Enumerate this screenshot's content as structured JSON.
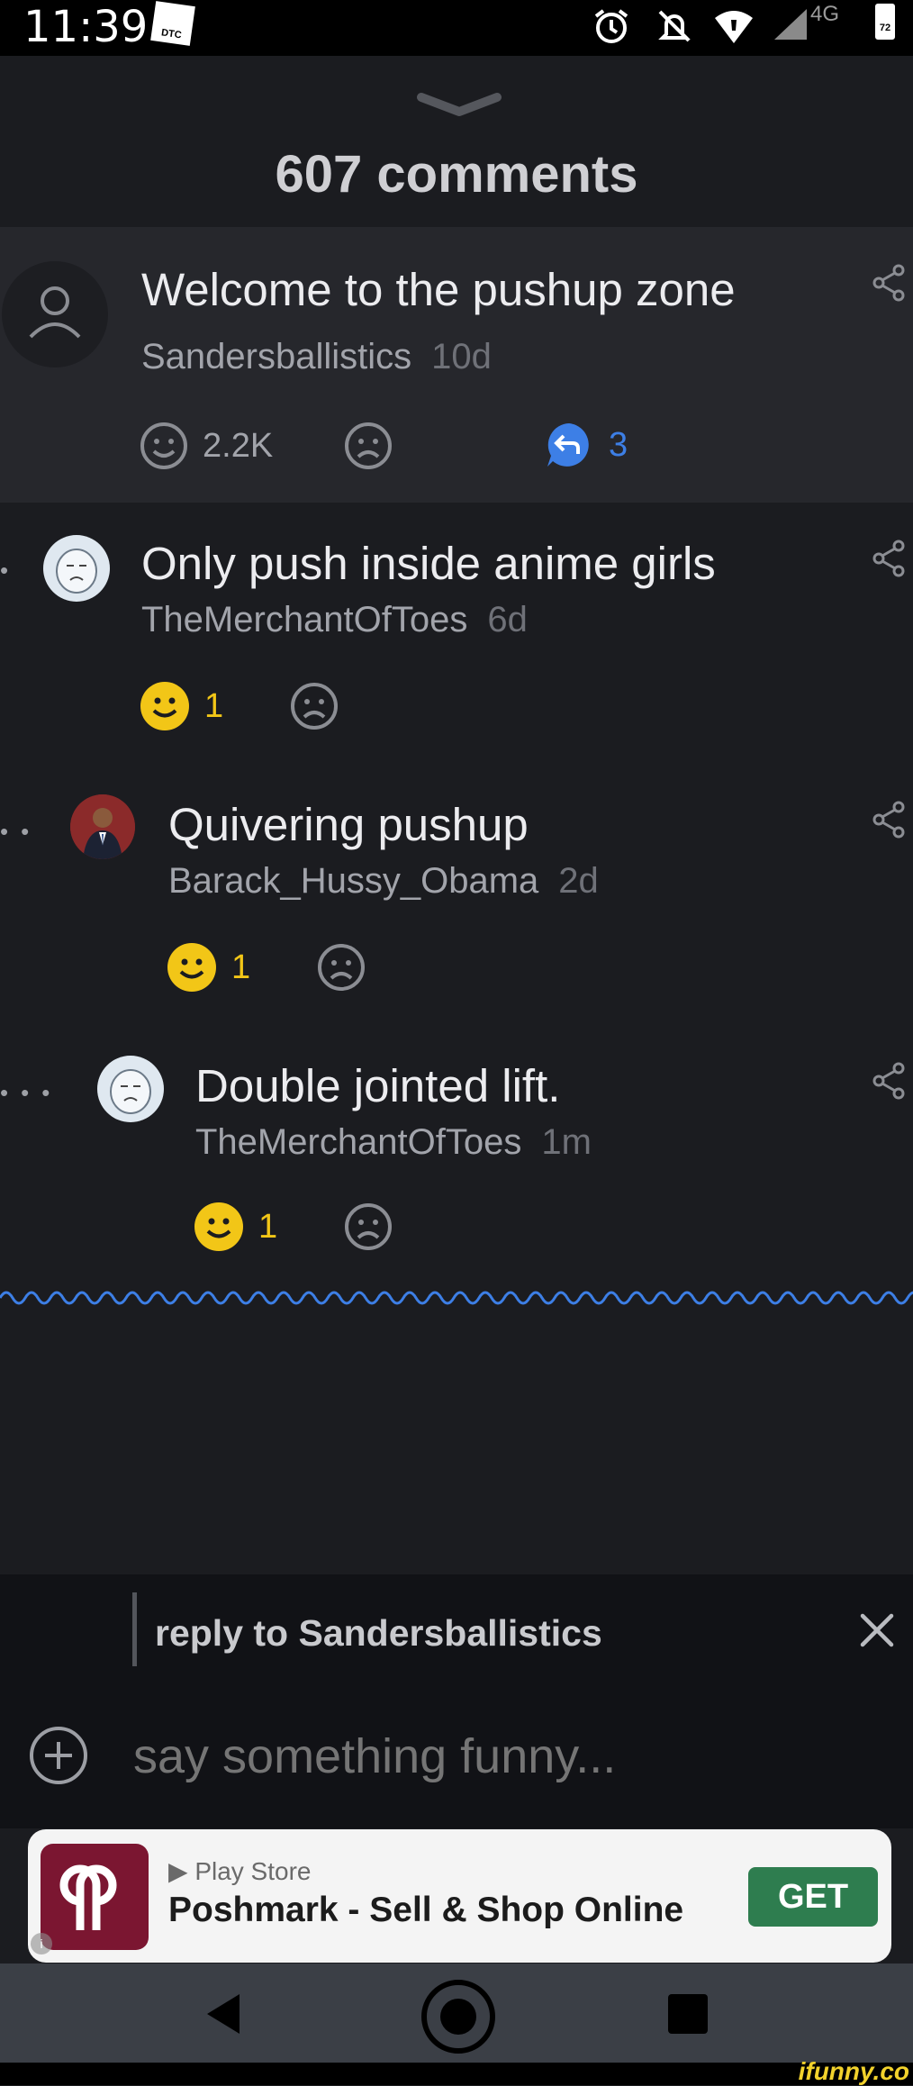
{
  "status_bar": {
    "time": "11:39",
    "network": "4G",
    "battery": "72",
    "dtc_badge": "DTC"
  },
  "header": {
    "comment_count": "607 comments"
  },
  "comments": [
    {
      "text": "Welcome to the pushup zone",
      "author": "Sandersballistics",
      "age": "10d",
      "likes": "2.2K",
      "replies": "3"
    },
    {
      "text": "Only push inside anime girls",
      "author": "TheMerchantOfToes",
      "age": "6d",
      "likes": "1"
    },
    {
      "text": "Quivering pushup",
      "author": "Barack_Hussy_Obama",
      "age": "2d",
      "likes": "1"
    },
    {
      "text": "Double jointed lift.",
      "author": "TheMerchantOfToes",
      "age": "1m",
      "likes": "1"
    }
  ],
  "reply": {
    "label": "reply to Sandersballistics",
    "placeholder": "say something funny..."
  },
  "ad": {
    "store": "Play Store",
    "title": "Poshmark - Sell & Shop Online",
    "cta": "GET"
  },
  "watermark": "ifunny.co",
  "colors": {
    "accent_blue": "#3d7fe6",
    "smile_yellow": "#f2c617",
    "ad_green": "#2e7d4f"
  }
}
